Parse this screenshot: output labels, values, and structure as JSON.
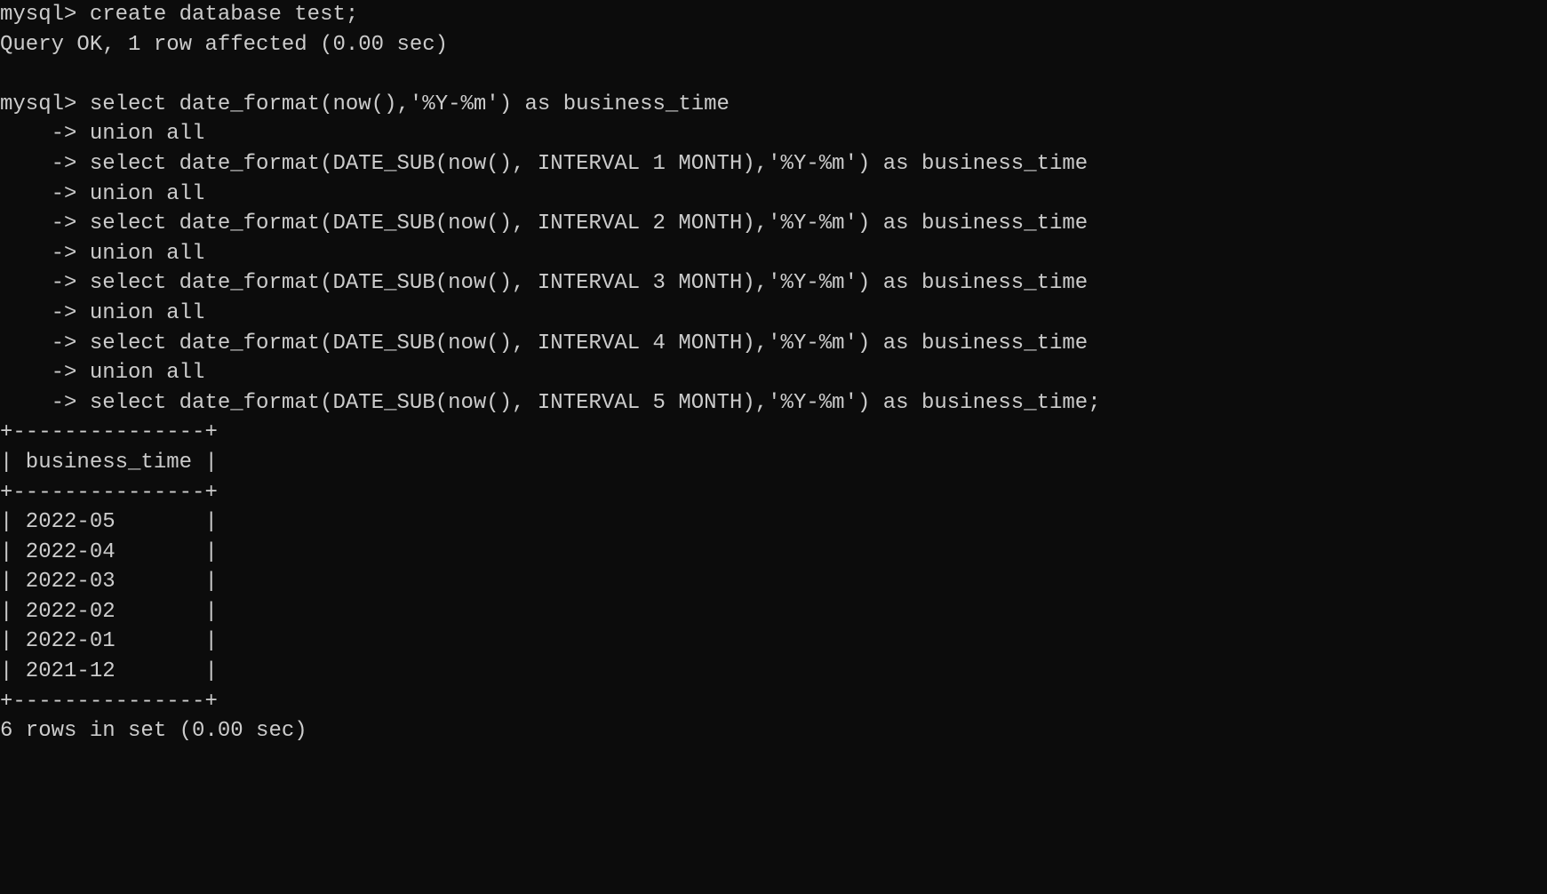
{
  "prompt": "mysql>",
  "cont_prompt": "    ->",
  "cmd_create": " create database test;",
  "resp_create": "Query OK, 1 row affected (0.00 sec)",
  "blank": "",
  "query": {
    "l0": " select date_format(now(),'%Y-%m') as business_time",
    "l1": " union all",
    "l2": " select date_format(DATE_SUB(now(), INTERVAL 1 MONTH),'%Y-%m') as business_time",
    "l3": " union all",
    "l4": " select date_format(DATE_SUB(now(), INTERVAL 2 MONTH),'%Y-%m') as business_time",
    "l5": " union all",
    "l6": " select date_format(DATE_SUB(now(), INTERVAL 3 MONTH),'%Y-%m') as business_time",
    "l7": " union all",
    "l8": " select date_format(DATE_SUB(now(), INTERVAL 4 MONTH),'%Y-%m') as business_time",
    "l9": " union all",
    "l10": " select date_format(DATE_SUB(now(), INTERVAL 5 MONTH),'%Y-%m') as business_time;"
  },
  "table": {
    "border_top": "+---------------+",
    "header": "| business_time |",
    "border_mid": "+---------------+",
    "rows": [
      "| 2022-05       |",
      "| 2022-04       |",
      "| 2022-03       |",
      "| 2022-02       |",
      "| 2022-01       |",
      "| 2021-12       |"
    ],
    "border_bot": "+---------------+"
  },
  "footer": "6 rows in set (0.00 sec)",
  "result_values": {
    "column": "business_time",
    "rows": [
      "2022-05",
      "2022-04",
      "2022-03",
      "2022-02",
      "2022-01",
      "2021-12"
    ],
    "row_count": 6,
    "elapsed": "0.00 sec"
  }
}
